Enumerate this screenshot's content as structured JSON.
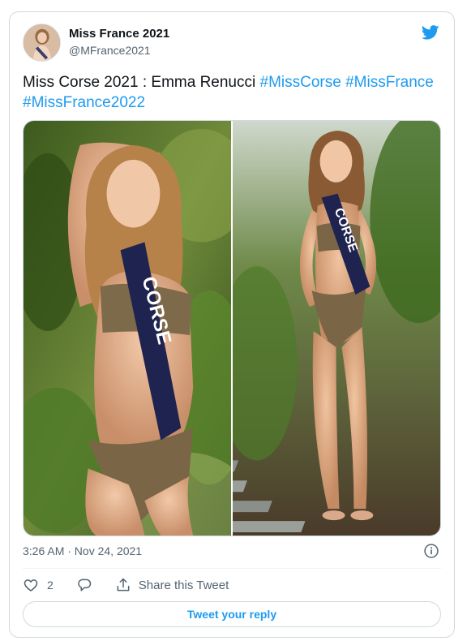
{
  "account": {
    "display_name": "Miss France 2021",
    "handle": "@MFrance2021"
  },
  "tweet": {
    "text_plain": "Miss Corse 2021 : Emma Renucci ",
    "hashtags": [
      "#MissCorse",
      "#MissFrance",
      "#MissFrance2022"
    ],
    "timestamp": "3:26 AM · Nov 24, 2021"
  },
  "media": {
    "photos": [
      {
        "sash_text": "CORSE"
      },
      {
        "sash_text": "CORSE"
      }
    ]
  },
  "actions": {
    "like_count": "2",
    "share_label": "Share this Tweet",
    "reply_button_label": "Tweet your reply"
  },
  "icons": {
    "logo": "twitter-bird-icon",
    "info": "info-icon",
    "like": "heart-icon",
    "reply": "reply-icon",
    "share": "share-icon"
  },
  "colors": {
    "accent": "#1d9bf0",
    "text": "#0f1419",
    "muted": "#536471",
    "border": "#cfd9de"
  }
}
